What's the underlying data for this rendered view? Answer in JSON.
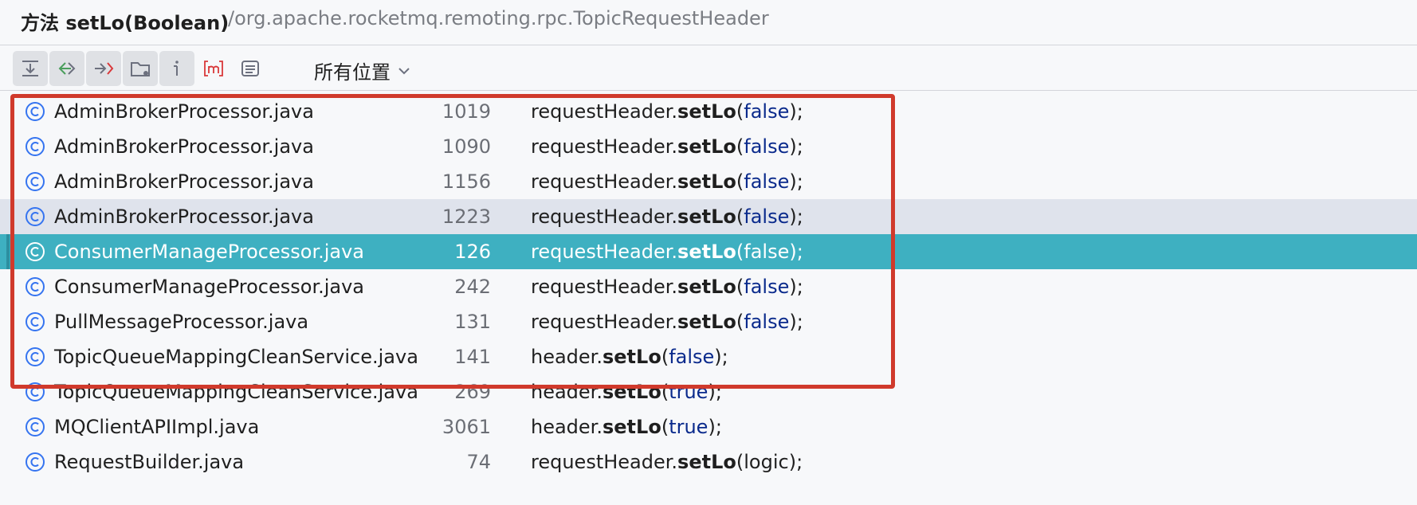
{
  "header": {
    "kind_label": "方法 setLo(Boolean)",
    "path": "/org.apache.rocketmq.remoting.rpc.TopicRequestHeader"
  },
  "toolbar": {
    "buttons": [
      {
        "icon": "expand-all-icon",
        "pressed": true
      },
      {
        "icon": "read-access-icon",
        "pressed": true
      },
      {
        "icon": "write-access-icon",
        "pressed": true
      },
      {
        "icon": "module-folder-icon",
        "pressed": true
      },
      {
        "icon": "info-icon",
        "pressed": true
      },
      {
        "icon": "method-icon",
        "pressed": false
      },
      {
        "icon": "preview-icon",
        "pressed": false
      }
    ],
    "scope_label": "所有位置"
  },
  "rows": [
    {
      "file": "AdminBrokerProcessor.java",
      "line": "1019",
      "receiver": "requestHeader.",
      "method": "setLo",
      "open": "(",
      "arg": "false",
      "close": ");",
      "arg_kw": true,
      "state": "normal"
    },
    {
      "file": "AdminBrokerProcessor.java",
      "line": "1090",
      "receiver": "requestHeader.",
      "method": "setLo",
      "open": "(",
      "arg": "false",
      "close": ");",
      "arg_kw": true,
      "state": "normal"
    },
    {
      "file": "AdminBrokerProcessor.java",
      "line": "1156",
      "receiver": "requestHeader.",
      "method": "setLo",
      "open": "(",
      "arg": "false",
      "close": ");",
      "arg_kw": true,
      "state": "normal"
    },
    {
      "file": "AdminBrokerProcessor.java",
      "line": "1223",
      "receiver": "requestHeader.",
      "method": "setLo",
      "open": "(",
      "arg": "false",
      "close": ");",
      "arg_kw": true,
      "state": "hover"
    },
    {
      "file": "ConsumerManageProcessor.java",
      "line": "126",
      "receiver": "requestHeader.",
      "method": "setLo",
      "open": "(",
      "arg": "false",
      "close": ");",
      "arg_kw": true,
      "state": "selected"
    },
    {
      "file": "ConsumerManageProcessor.java",
      "line": "242",
      "receiver": "requestHeader.",
      "method": "setLo",
      "open": "(",
      "arg": "false",
      "close": ");",
      "arg_kw": true,
      "state": "normal"
    },
    {
      "file": "PullMessageProcessor.java",
      "line": "131",
      "receiver": "requestHeader.",
      "method": "setLo",
      "open": "(",
      "arg": "false",
      "close": ");",
      "arg_kw": true,
      "state": "normal"
    },
    {
      "file": "TopicQueueMappingCleanService.java",
      "line": "141",
      "receiver": "header.",
      "method": "setLo",
      "open": "(",
      "arg": "false",
      "close": ");",
      "arg_kw": true,
      "state": "normal"
    },
    {
      "file": "TopicQueueMappingCleanService.java",
      "line": "269",
      "receiver": "header.",
      "method": "setLo",
      "open": "(",
      "arg": "true",
      "close": ");",
      "arg_kw": true,
      "state": "normal"
    },
    {
      "file": "MQClientAPIImpl.java",
      "line": "3061",
      "receiver": "header.",
      "method": "setLo",
      "open": "(",
      "arg": "true",
      "close": ");",
      "arg_kw": true,
      "state": "normal"
    },
    {
      "file": "RequestBuilder.java",
      "line": "74",
      "receiver": "requestHeader.",
      "method": "setLo",
      "open": "(",
      "arg": "logic",
      "close": ");",
      "arg_kw": false,
      "state": "normal"
    }
  ],
  "footer_text": "",
  "colors": {
    "selection": "#3eb0c1",
    "hover": "#dfe3ec",
    "highlight_frame": "#d03a2c",
    "keyword": "#0a2a8c",
    "class_icon": "#3574f0"
  }
}
